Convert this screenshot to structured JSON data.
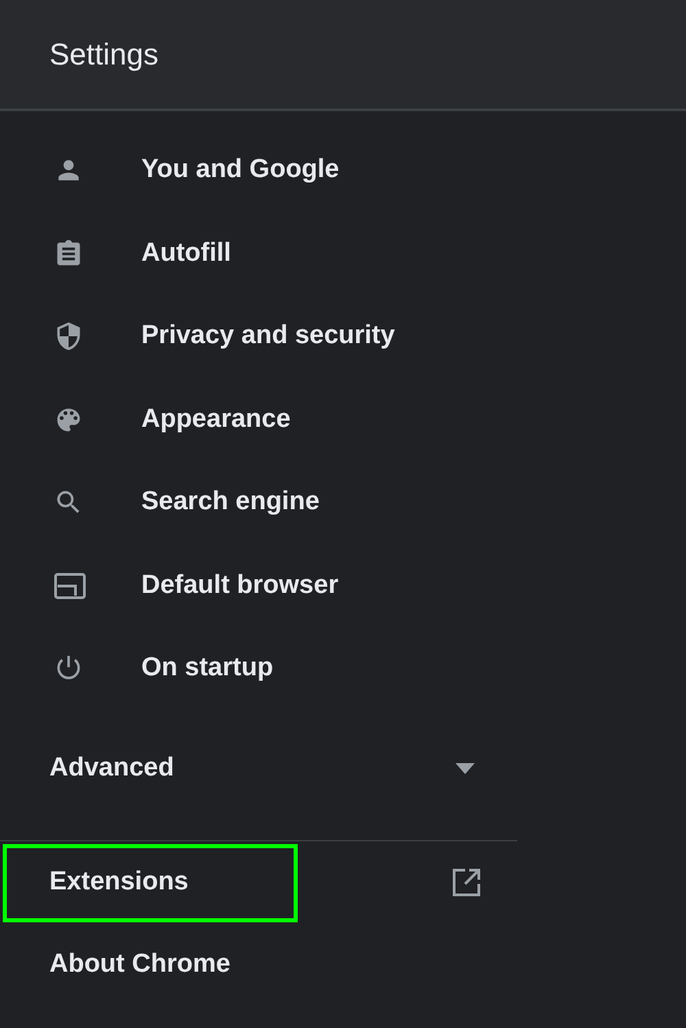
{
  "header": {
    "title": "Settings"
  },
  "menu": [
    {
      "label": "You and Google"
    },
    {
      "label": "Autofill"
    },
    {
      "label": "Privacy and security"
    },
    {
      "label": "Appearance"
    },
    {
      "label": "Search engine"
    },
    {
      "label": "Default browser"
    },
    {
      "label": "On startup"
    }
  ],
  "advanced": {
    "label": "Advanced",
    "expanded": false
  },
  "links": [
    {
      "label": "Extensions",
      "external": true,
      "highlighted": true
    },
    {
      "label": "About Chrome",
      "external": false,
      "highlighted": false
    }
  ]
}
